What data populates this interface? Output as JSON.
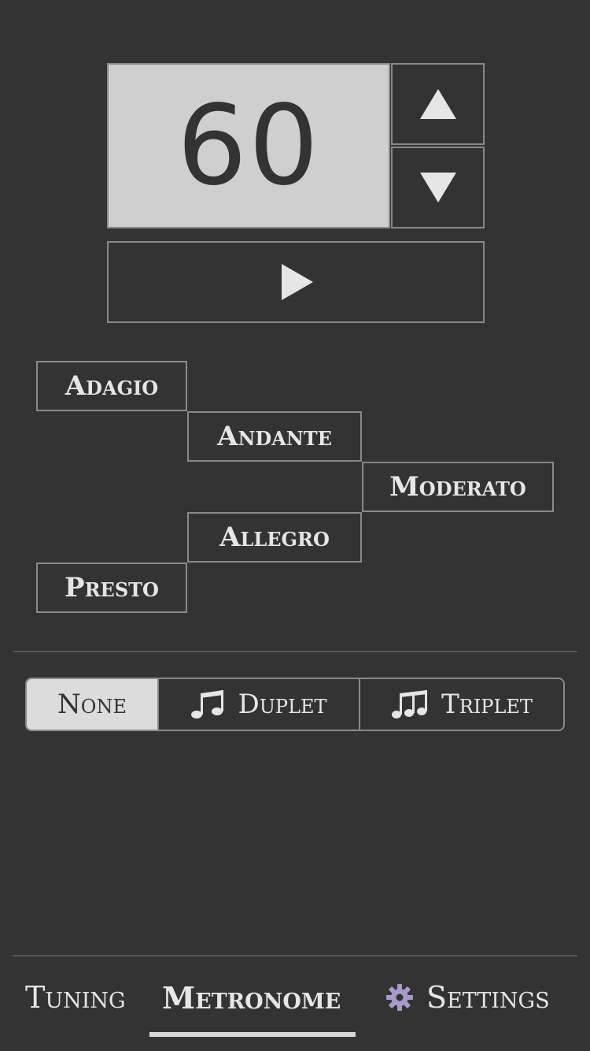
{
  "metronome": {
    "bpm": "60",
    "increment_icon": "triangle-up-icon",
    "decrement_icon": "triangle-down-icon",
    "play_icon": "play-icon"
  },
  "tempos": {
    "adagio": "Adagio",
    "andante": "Andante",
    "moderato": "Moderato",
    "allegro": "Allegro",
    "presto": "Presto"
  },
  "subdivision": {
    "options": [
      "None",
      "Duplet",
      "Triplet"
    ],
    "selected": "None",
    "duplet_icon": "eighth-notes-icon",
    "triplet_icon": "triplet-notes-icon"
  },
  "nav": {
    "tuning": "Tuning",
    "metronome": "Metronome",
    "settings": "Settings",
    "settings_icon": "gear-icon",
    "active": "Metronome"
  },
  "colors": {
    "background": "#333333",
    "display_bg": "#cfcfcf",
    "border": "#8a8a8a",
    "selected_segment": "#dcdcdc",
    "gear": "#a99ac9"
  }
}
